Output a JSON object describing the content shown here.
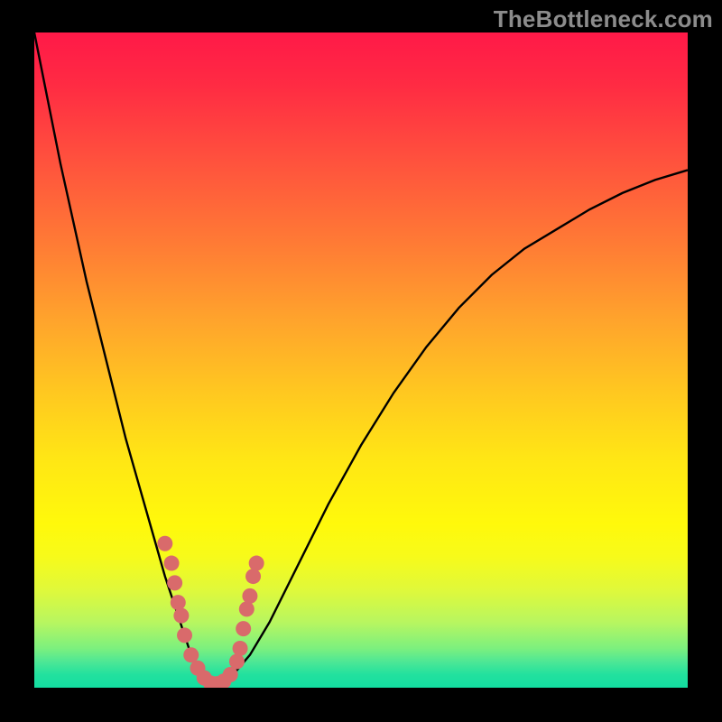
{
  "watermark": "TheBottleneck.com",
  "colors": {
    "background": "#000000",
    "gradient_top": "#ff1948",
    "gradient_bottom": "#13dda1",
    "watermark_text": "#8c8c8c",
    "curve": "#000000",
    "markers": "#d96a6b"
  },
  "chart_data": {
    "type": "line",
    "title": "",
    "xlabel": "",
    "ylabel": "",
    "xlim": [
      0,
      100
    ],
    "ylim": [
      0,
      100
    ],
    "grid": false,
    "legend": false,
    "annotations": [],
    "series": [
      {
        "name": "bottleneck-curve",
        "x": [
          0,
          2,
          4,
          6,
          8,
          10,
          12,
          14,
          16,
          18,
          20,
          21,
          22,
          23,
          24,
          25,
          26,
          27,
          28,
          30,
          33,
          36,
          40,
          45,
          50,
          55,
          60,
          65,
          70,
          75,
          80,
          85,
          90,
          95,
          100
        ],
        "values": [
          100,
          90,
          80,
          71,
          62,
          54,
          46,
          38,
          31,
          24,
          17,
          14,
          11,
          8,
          5,
          3,
          2,
          1,
          0.5,
          1.5,
          5,
          10,
          18,
          28,
          37,
          45,
          52,
          58,
          63,
          67,
          70,
          73,
          75.5,
          77.5,
          79
        ]
      }
    ],
    "markers": [
      {
        "x": 20,
        "y": 22
      },
      {
        "x": 21,
        "y": 19
      },
      {
        "x": 21.5,
        "y": 16
      },
      {
        "x": 22,
        "y": 13
      },
      {
        "x": 22.5,
        "y": 11
      },
      {
        "x": 23,
        "y": 8
      },
      {
        "x": 24,
        "y": 5
      },
      {
        "x": 25,
        "y": 3
      },
      {
        "x": 26,
        "y": 1.5
      },
      {
        "x": 27,
        "y": 0.7
      },
      {
        "x": 28,
        "y": 0.6
      },
      {
        "x": 29,
        "y": 1
      },
      {
        "x": 30,
        "y": 2
      },
      {
        "x": 31,
        "y": 4
      },
      {
        "x": 31.5,
        "y": 6
      },
      {
        "x": 32,
        "y": 9
      },
      {
        "x": 32.5,
        "y": 12
      },
      {
        "x": 33,
        "y": 14
      },
      {
        "x": 33.5,
        "y": 17
      },
      {
        "x": 34,
        "y": 19
      }
    ]
  }
}
